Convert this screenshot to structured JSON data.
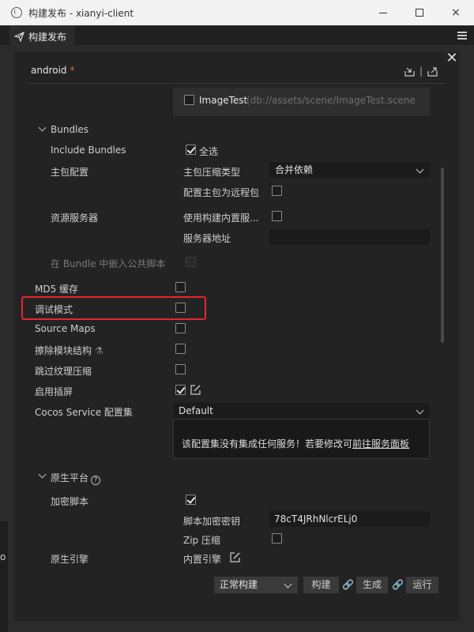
{
  "window": {
    "title": "构建发布 - xianyi-client",
    "minimize": "minimize",
    "maximize": "maximize",
    "close": "×"
  },
  "tab": {
    "label": "构建发布"
  },
  "panel": {
    "platform": "android",
    "unsaved_mark": "*"
  },
  "scene": {
    "name": "ImageTest",
    "path": "(db://assets/scene/ImageTest.scene"
  },
  "bundles": {
    "section_label": "Bundles",
    "include_label": "Include Bundles",
    "include_value": "全选",
    "main_config_label": "主包配置",
    "compress_type_label": "主包压缩类型",
    "compress_type_value": "合并依赖",
    "remote_label": "配置主包为远程包",
    "asset_server_label": "资源服务器",
    "use_builtin_label": "使用构建内置服...",
    "server_addr_label": "服务器地址",
    "embed_label": "在 Bundle 中嵌入公共脚本"
  },
  "options": {
    "md5": "MD5 缓存",
    "debug": "调试模式",
    "source_maps": "Source Maps",
    "erase_modules": "擦除模块结构",
    "erase_modules_badge": "⚗",
    "skip_texture": "跳过纹理压缩",
    "splash": "启用插屏",
    "cocos_service": "Cocos Service 配置集",
    "cocos_service_value": "Default"
  },
  "info": {
    "text": "该配置集没有集成任何服务！若要修改可",
    "link": "前往服务面板"
  },
  "native": {
    "section_label": "原生平台",
    "help": "?",
    "encrypt_label": "加密脚本",
    "encrypt_key_label": "脚本加密密钥",
    "encrypt_key_value": "78cT4JRhNlcrELj0",
    "zip_label": "Zip 压缩",
    "engine_label": "原生引擎",
    "engine_value": "内置引擎"
  },
  "footer": {
    "build_mode": "正常构建",
    "build": "构建",
    "make": "生成",
    "run": "运行"
  },
  "edge": {
    "text": "o"
  }
}
